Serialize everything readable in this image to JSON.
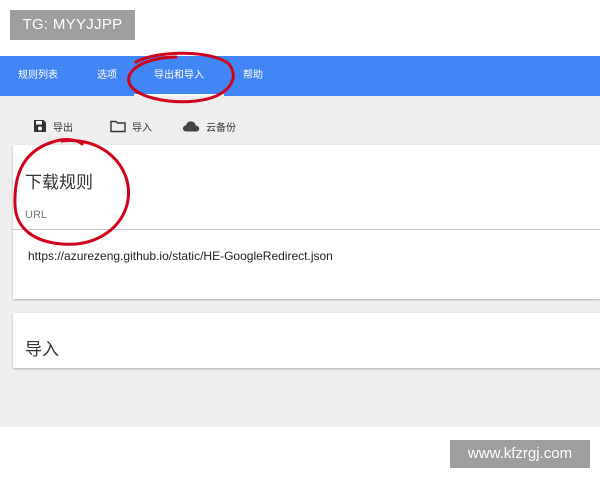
{
  "watermarks": {
    "top": "TG: MYYJJPP",
    "bottom": "www.kfzrgj.com"
  },
  "tabs": [
    {
      "label": "规则列表"
    },
    {
      "label": "选项"
    },
    {
      "label": "导出和导入",
      "active": true
    },
    {
      "label": "帮助"
    }
  ],
  "toolbar": {
    "export_label": "导出",
    "import_label": "导入",
    "cloud_label": "云备份"
  },
  "download_card": {
    "title": "下载规则",
    "field_label": "URL",
    "field_value": "https://azurezeng.github.io/static/HE-GoogleRedirect.json"
  },
  "import_card": {
    "title": "导入"
  },
  "icons": {
    "export": "save-icon",
    "import": "folder-icon",
    "cloud": "cloud-icon"
  },
  "colors": {
    "tab_bar": "#4285f4",
    "background": "#eeeeee",
    "annotation": "#d0021b",
    "watermark_bg": "#9e9e9e"
  }
}
